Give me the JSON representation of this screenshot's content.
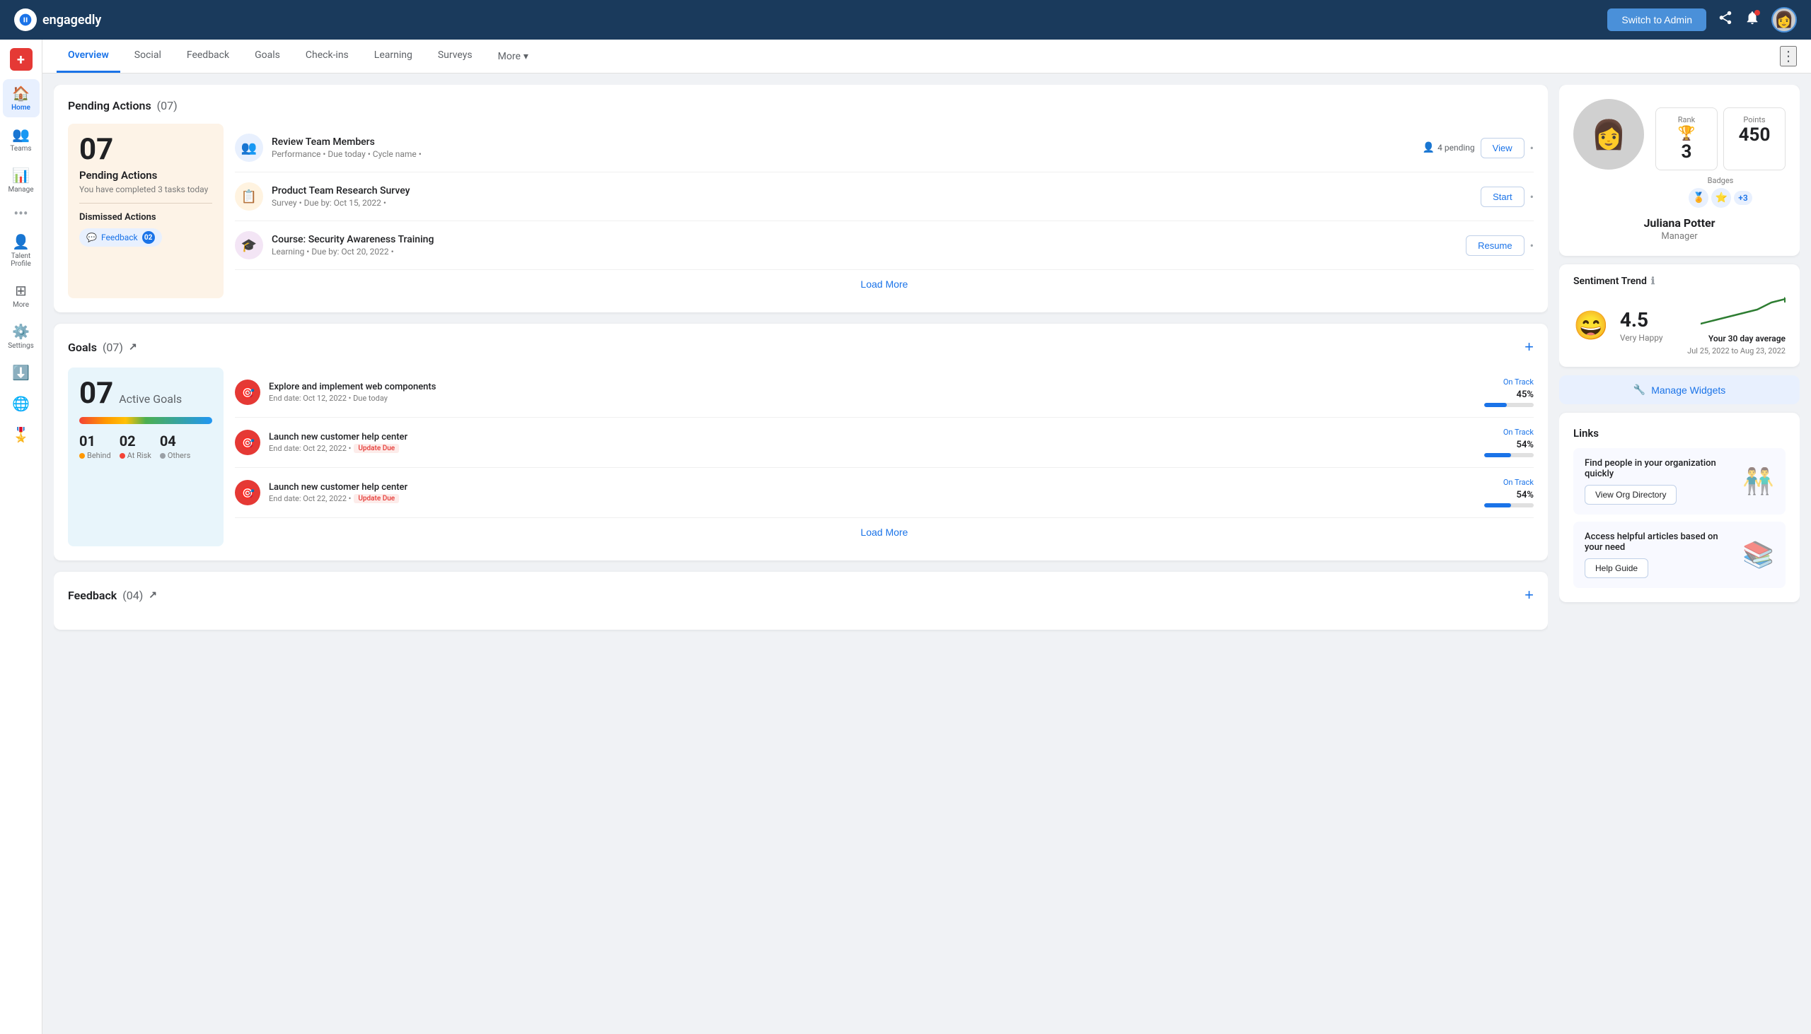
{
  "app": {
    "name": "engagedly",
    "logo_alt": "Engagedly Logo"
  },
  "topnav": {
    "switch_admin_label": "Switch to Admin",
    "avatar_alt": "Juliana Potter avatar"
  },
  "sidebar": {
    "add_icon": "+",
    "items": [
      {
        "label": "Home",
        "icon": "🏠",
        "active": true
      },
      {
        "label": "Teams",
        "icon": "👥",
        "active": false
      },
      {
        "label": "Manage",
        "icon": "📊",
        "active": false
      },
      {
        "label": "...",
        "icon": "...",
        "active": false
      },
      {
        "label": "Talent Profile",
        "icon": "👤",
        "active": false
      },
      {
        "label": "More",
        "icon": "⊞",
        "active": false
      },
      {
        "label": "Settings",
        "icon": "⚙️",
        "active": false
      },
      {
        "label": "Download",
        "icon": "⬇️",
        "active": false
      },
      {
        "label": "Globe",
        "icon": "🌐",
        "active": false
      },
      {
        "label": "Rewards",
        "icon": "🎖️",
        "active": false
      }
    ]
  },
  "tabs": [
    {
      "label": "Overview",
      "active": true
    },
    {
      "label": "Social",
      "active": false
    },
    {
      "label": "Feedback",
      "active": false
    },
    {
      "label": "Goals",
      "active": false
    },
    {
      "label": "Check-ins",
      "active": false
    },
    {
      "label": "Learning",
      "active": false
    },
    {
      "label": "Surveys",
      "active": false
    },
    {
      "label": "More",
      "active": false,
      "has_chevron": true
    }
  ],
  "pending_actions": {
    "section_title": "Pending Actions",
    "count": "(07)",
    "summary": {
      "number": "07",
      "label": "Pending Actions",
      "sublabel": "You have completed 3 tasks today",
      "dismissed_title": "Dismissed Actions",
      "feedback_label": "Feedback",
      "feedback_count": "02"
    },
    "items": [
      {
        "icon": "👥",
        "icon_color": "blue",
        "title": "Review Team Members",
        "meta": "Performance  •  Due today  •  Cycle name  •",
        "pending_count": "4 pending",
        "action_label": "View"
      },
      {
        "icon": "📋",
        "icon_color": "orange",
        "title": "Product Team Research Survey",
        "meta": "Survey  •  Due by: Oct 15, 2022  •",
        "pending_count": null,
        "action_label": "Start"
      },
      {
        "icon": "🎓",
        "icon_color": "purple",
        "title": "Course: Security Awareness Training",
        "meta": "Learning  •  Due by: Oct 20, 2022  •",
        "pending_count": null,
        "action_label": "Resume"
      }
    ],
    "load_more": "Load More"
  },
  "goals": {
    "section_title": "Goals",
    "count": "(07)",
    "summary": {
      "number": "07",
      "label": "Active Goals",
      "stats": [
        {
          "num": "01",
          "label": "Behind",
          "dot_color": "orange"
        },
        {
          "num": "02",
          "label": "At Risk",
          "dot_color": "red"
        },
        {
          "num": "04",
          "label": "Others",
          "dot_color": "gray"
        }
      ]
    },
    "items": [
      {
        "title": "Explore and implement web components",
        "meta": "End date: Oct 12, 2022  •  Due today",
        "update_due": null,
        "status": "On Track",
        "percent": "45%",
        "percent_val": 45
      },
      {
        "title": "Launch new customer help center",
        "meta": "End date: Oct 22, 2022  •",
        "update_due": "Update Due",
        "status": "On Track",
        "percent": "54%",
        "percent_val": 54
      },
      {
        "title": "Launch new customer help center",
        "meta": "End date: Oct 22, 2022  •",
        "update_due": "Update Due",
        "status": "On Track",
        "percent": "54%",
        "percent_val": 54
      }
    ],
    "load_more": "Load More"
  },
  "feedback": {
    "section_title": "Feedback",
    "count": "(04)"
  },
  "profile": {
    "name": "Juliana Potter",
    "role": "Manager",
    "rank_label": "Rank",
    "rank_value": "3",
    "points_label": "Points",
    "points_value": "450",
    "badges_label": "Badges",
    "badges": [
      "🏅",
      "⭐"
    ],
    "badges_plus": "+3"
  },
  "sentiment": {
    "title": "Sentiment Trend",
    "score": "4.5",
    "label": "Very Happy",
    "avg_label": "Your 30 day average",
    "date_range": "Jul 25, 2022 to Aug 23, 2022"
  },
  "manage_widgets": {
    "label": "Manage Widgets",
    "icon": "🔧"
  },
  "links": {
    "title": "Links",
    "items": [
      {
        "title": "Find people in your organization quickly",
        "button_label": "View Org Directory"
      },
      {
        "title": "Access helpful articles based on your need",
        "button_label": "Help Guide"
      }
    ]
  }
}
